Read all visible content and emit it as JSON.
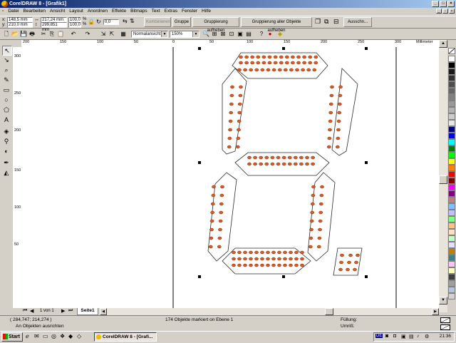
{
  "window": {
    "title": "CorelDRAW 8 - [Grafik1]"
  },
  "menu": [
    "Datei",
    "Bearbeiten",
    "Ansicht",
    "Layout",
    "Anordnen",
    "Effekte",
    "Bitmaps",
    "Text",
    "Extras",
    "Fenster",
    "Hilfe"
  ],
  "property_bar": {
    "x": "148,5 mm",
    "y": "210,0 mm",
    "width": "217,24 mm",
    "height": "299,851 mm",
    "scale_x": "100,0",
    "scale_y": "100,0",
    "pct": "%",
    "angle": "0,0",
    "combine_label": "Kombinieren",
    "group_label": "Gruppe",
    "ungroup_label": "Gruppierung aufheben",
    "ungroup_all_label": "Gruppierung aller Objekte aufheben",
    "outline_label": "Ausschn..."
  },
  "standard_bar": {
    "view_mode": "Normalansicht",
    "zoom": "150%"
  },
  "ruler": {
    "unit": "Millimeter",
    "h_labels": [
      "200",
      "150",
      "100",
      "50",
      "0",
      "50",
      "100",
      "150",
      "200",
      "250",
      "300"
    ],
    "v_labels": [
      "300",
      "250",
      "200",
      "150",
      "100",
      "50"
    ]
  },
  "page_nav": {
    "position": "1 von 1",
    "tab": "Seite1"
  },
  "status": {
    "coords": "( 284,747; 214,274 )",
    "hint": "An Objekten ausrichten",
    "selection": "174 Objekte markiert on Ebene 1",
    "fill_label": "Füllung:",
    "outline_label": "Umriß:"
  },
  "taskbar": {
    "start": "Start",
    "task": "CorelDRAW 8 - [Grafi...",
    "clock": "21:36",
    "tray_lang": "DE"
  },
  "colors": {
    "title_start": "#0a246a",
    "title_end": "#a6caf0",
    "led_fill": "#e05a20",
    "led_stroke": "#2a2a2a",
    "palette": [
      "#ffffff",
      "#000000",
      "#1a1a1a",
      "#333333",
      "#4d4d4d",
      "#666666",
      "#808080",
      "#999999",
      "#b3b3b3",
      "#cccccc",
      "#e6e6e6",
      "#000080",
      "#0000ff",
      "#00ffff",
      "#008000",
      "#00ff00",
      "#ffff00",
      "#ff8000",
      "#ff0000",
      "#800000",
      "#ff00ff",
      "#800080",
      "#c08080",
      "#80c0ff",
      "#c0c0ff",
      "#80ff80",
      "#ffc080",
      "#ffe0c0",
      "#c0ffc0",
      "#e0e0ff",
      "#c08000",
      "#408080",
      "#ffc0ff",
      "#ffffc0",
      "#404040",
      "#a0a0a0",
      "#b0c4de",
      "#d0d0d0"
    ]
  }
}
